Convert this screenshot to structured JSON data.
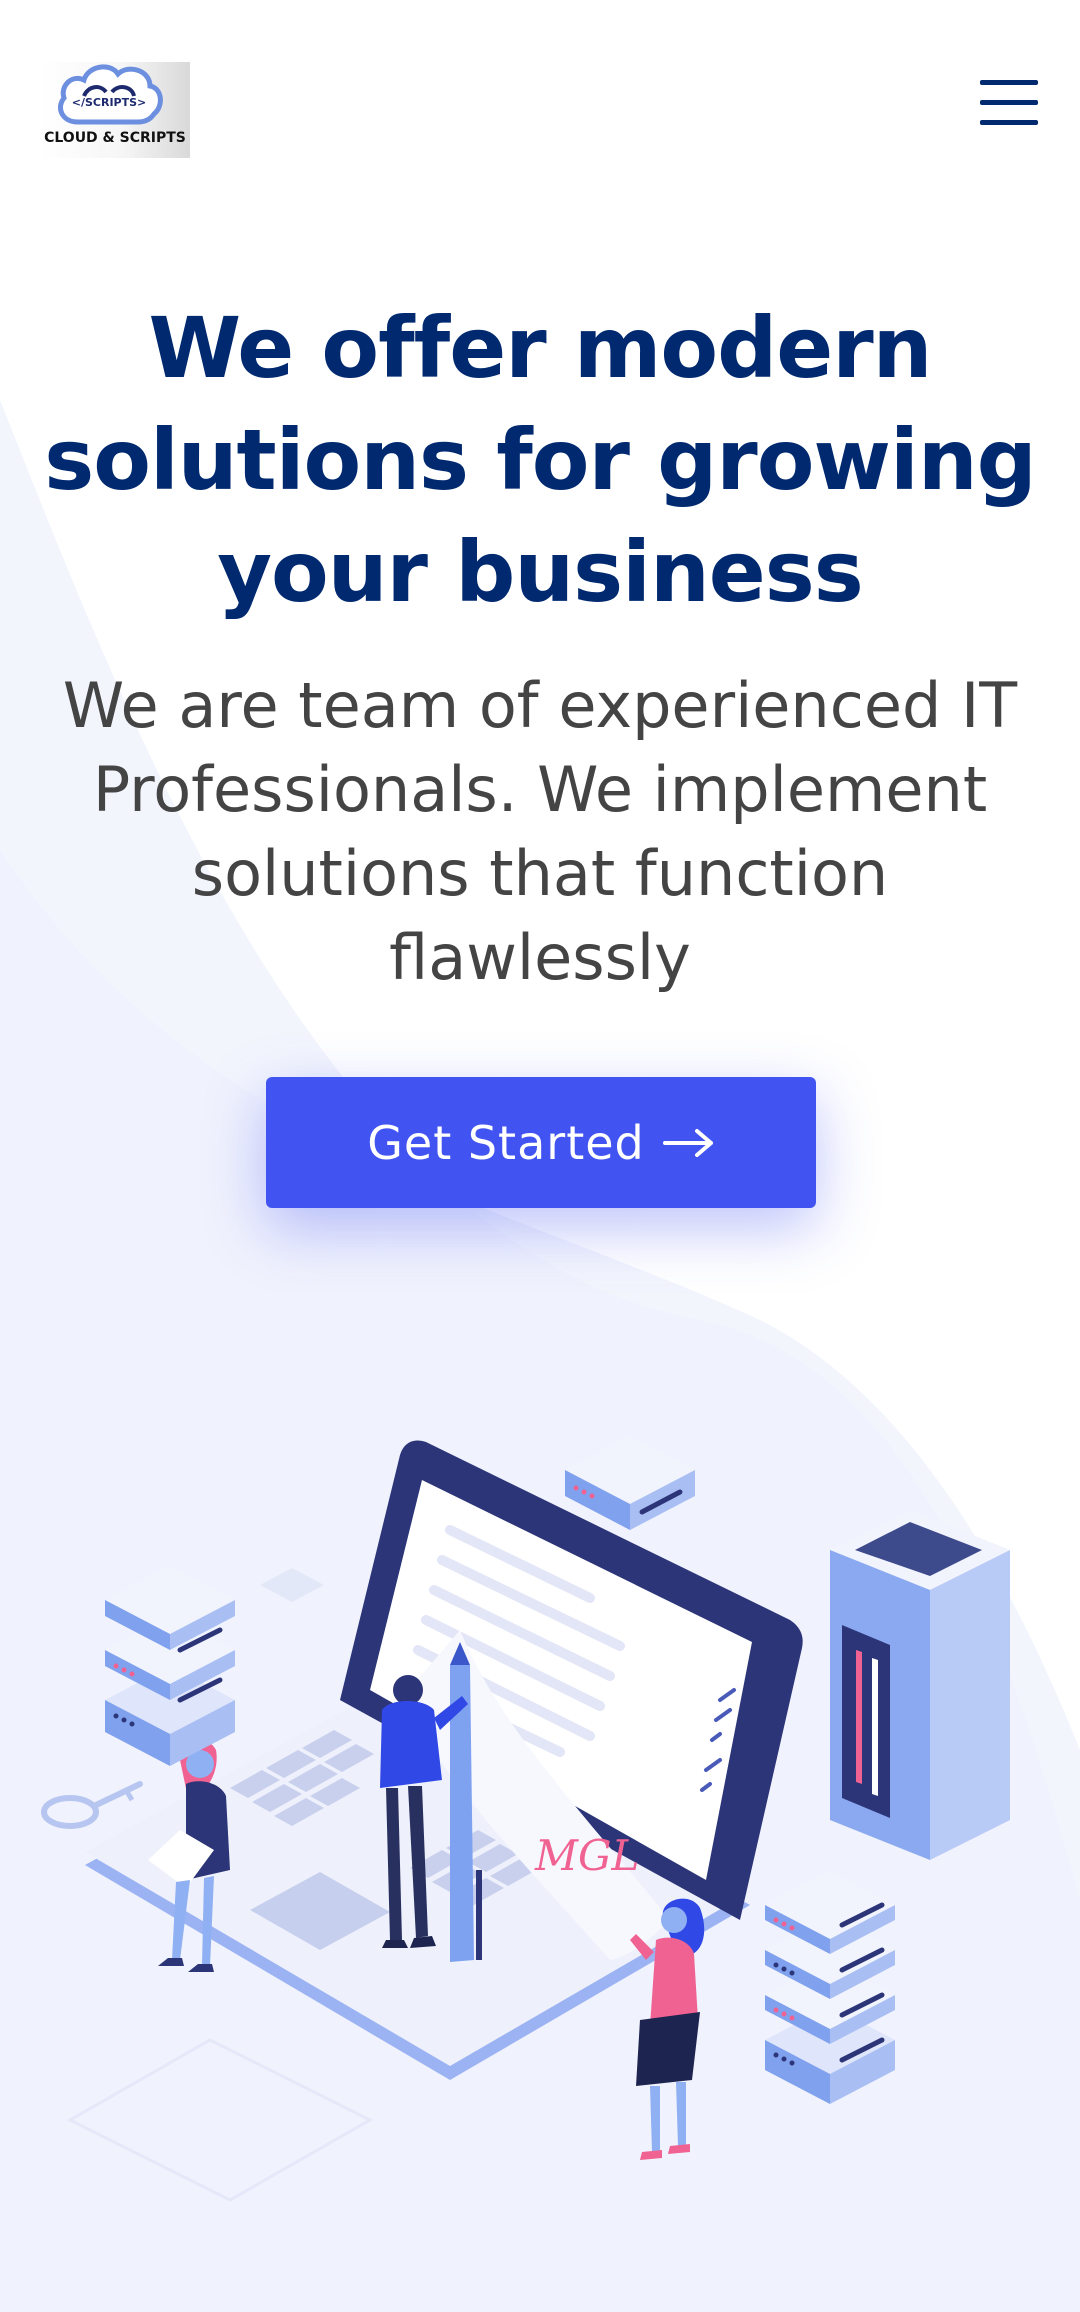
{
  "header": {
    "logo_label": "</SCRIPTS>",
    "logo_text": "CLOUD & SCRIPTS",
    "menu_icon": "hamburger-menu-icon"
  },
  "hero": {
    "title": "We offer modern solutions for growing your business",
    "subtitle": "We are team of experienced IT Professionals. We implement solutions that function flawlessly",
    "cta_label": "Get Started",
    "cta_icon": "arrow-right-icon"
  },
  "colors": {
    "primary": "#4154f1",
    "heading": "#012970",
    "body_text": "#444444",
    "background_tint": "#f3f5fd"
  },
  "illustration": {
    "signature": "MGL"
  }
}
